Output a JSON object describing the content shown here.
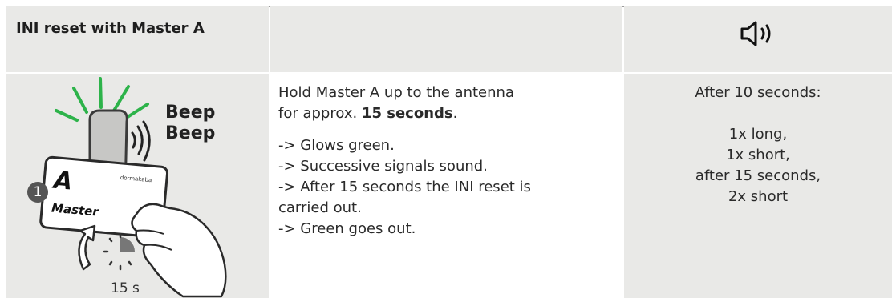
{
  "header": {
    "title": "INI reset with Master A",
    "speaker_icon": "speaker-sound-icon"
  },
  "illustration": {
    "beep1": "Beep",
    "beep2": "Beep",
    "step_number": "1",
    "card_letter": "A",
    "card_label": "Master",
    "card_brand": "dormakaba",
    "duration": "15 s",
    "colors": {
      "glow": "#2db34a",
      "step_badge": "#555555"
    }
  },
  "instructions": {
    "line1": "Hold Master A up to the antenna",
    "line2_pre": "for approx. ",
    "line2_bold": "15 seconds",
    "line2_post": ".",
    "steps": [
      "-> Glows green.",
      "-> Successive signals sound.",
      "-> After 15 seconds the INI reset is",
      "carried out.",
      "-> Green goes out."
    ]
  },
  "signals": {
    "intro": "After 10 seconds:",
    "lines": [
      "1x long,",
      "1x short,",
      "after 15 seconds,",
      "2x short"
    ]
  }
}
